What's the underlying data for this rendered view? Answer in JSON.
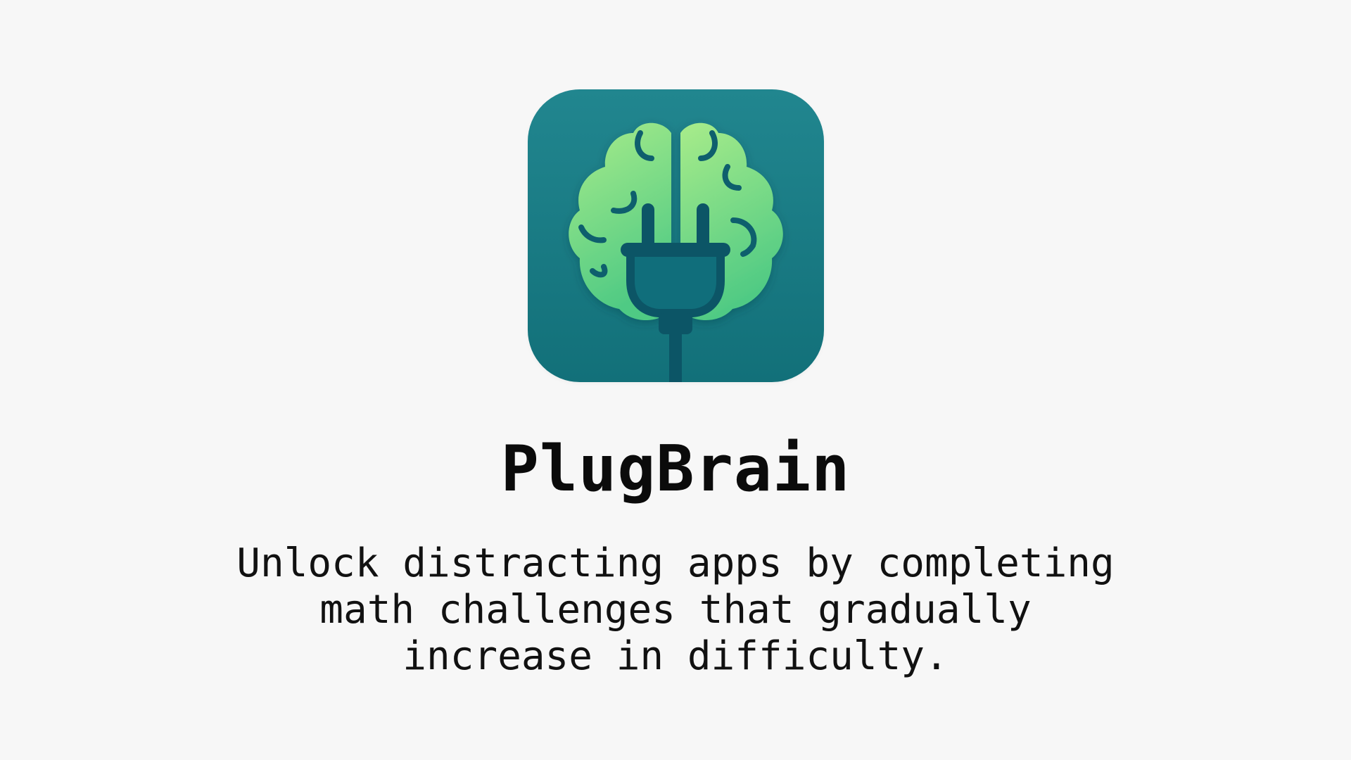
{
  "app": {
    "name": "PlugBrain",
    "icon": "brain-plug-icon",
    "tagline_lines": [
      "Unlock distracting apps by completing",
      "math challenges that gradually",
      "increase in difficulty."
    ]
  },
  "colors": {
    "background": "#f7f7f7",
    "icon_tile_top": "#21868f",
    "icon_tile_bottom": "#127079",
    "brain_light": "#a6ea88",
    "brain_dark": "#52cc84",
    "plug": "#0c5566",
    "text": "#0b0b0b"
  }
}
